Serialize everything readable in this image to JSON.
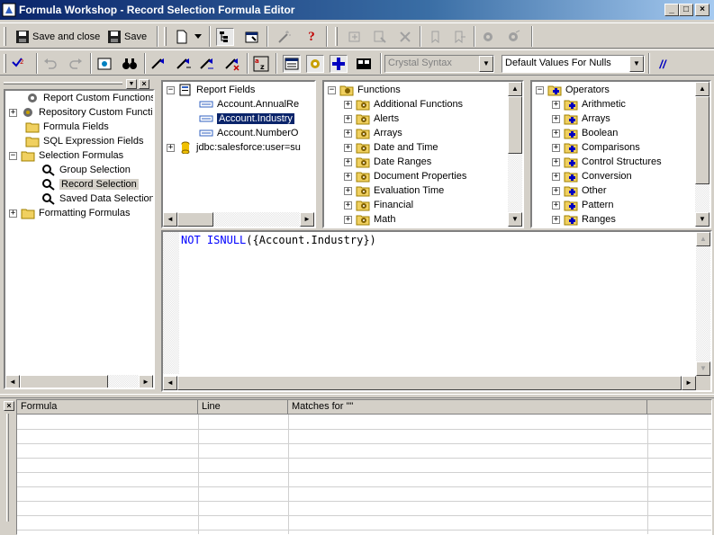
{
  "window": {
    "title": "Formula Workshop - Record Selection Formula Editor"
  },
  "toolbar1": {
    "save_close_label": "Save and close",
    "save_label": "Save"
  },
  "toolbar2": {
    "syntax_value": "Crystal Syntax",
    "nulls_value": "Default Values For Nulls"
  },
  "workshop_tree": {
    "items": [
      {
        "label": "Report Custom Functions",
        "icon": "gear-icon"
      },
      {
        "label": "Repository Custom Functic",
        "icon": "gear-icon"
      },
      {
        "label": "Formula Fields",
        "icon": "folder-icon"
      },
      {
        "label": "SQL Expression Fields",
        "icon": "folder-icon"
      },
      {
        "label": "Selection Formulas",
        "icon": "folder-icon"
      },
      {
        "label": "Group Selection",
        "icon": "formula-icon"
      },
      {
        "label": "Record Selection",
        "icon": "formula-icon"
      },
      {
        "label": "Saved Data Selection",
        "icon": "formula-icon"
      },
      {
        "label": "Formatting Formulas",
        "icon": "folder-icon"
      }
    ]
  },
  "fields_tree": {
    "items": [
      {
        "label": "Report Fields"
      },
      {
        "label": "Account.AnnualRe"
      },
      {
        "label": "Account.Industry"
      },
      {
        "label": "Account.NumberO"
      },
      {
        "label": "jdbc:salesforce:user=su"
      }
    ]
  },
  "functions_tree": {
    "root": "Functions",
    "items": [
      "Additional Functions",
      "Alerts",
      "Arrays",
      "Date and Time",
      "Date Ranges",
      "Document Properties",
      "Evaluation Time",
      "Financial",
      "Math"
    ]
  },
  "operators_tree": {
    "root": "Operators",
    "items": [
      "Arithmetic",
      "Arrays",
      "Boolean",
      "Comparisons",
      "Control Structures",
      "Conversion",
      "Other",
      "Pattern",
      "Ranges"
    ]
  },
  "editor": {
    "kw1": "NOT",
    "kw2": "ISNULL",
    "rest": "({Account.Industry})"
  },
  "errors_grid": {
    "columns": [
      "Formula",
      "Line",
      "Matches for \"\""
    ]
  },
  "colors": {
    "title_start": "#0a246a",
    "title_end": "#a6caf0",
    "keyword": "#0000ff",
    "selection": "#0a246a"
  }
}
